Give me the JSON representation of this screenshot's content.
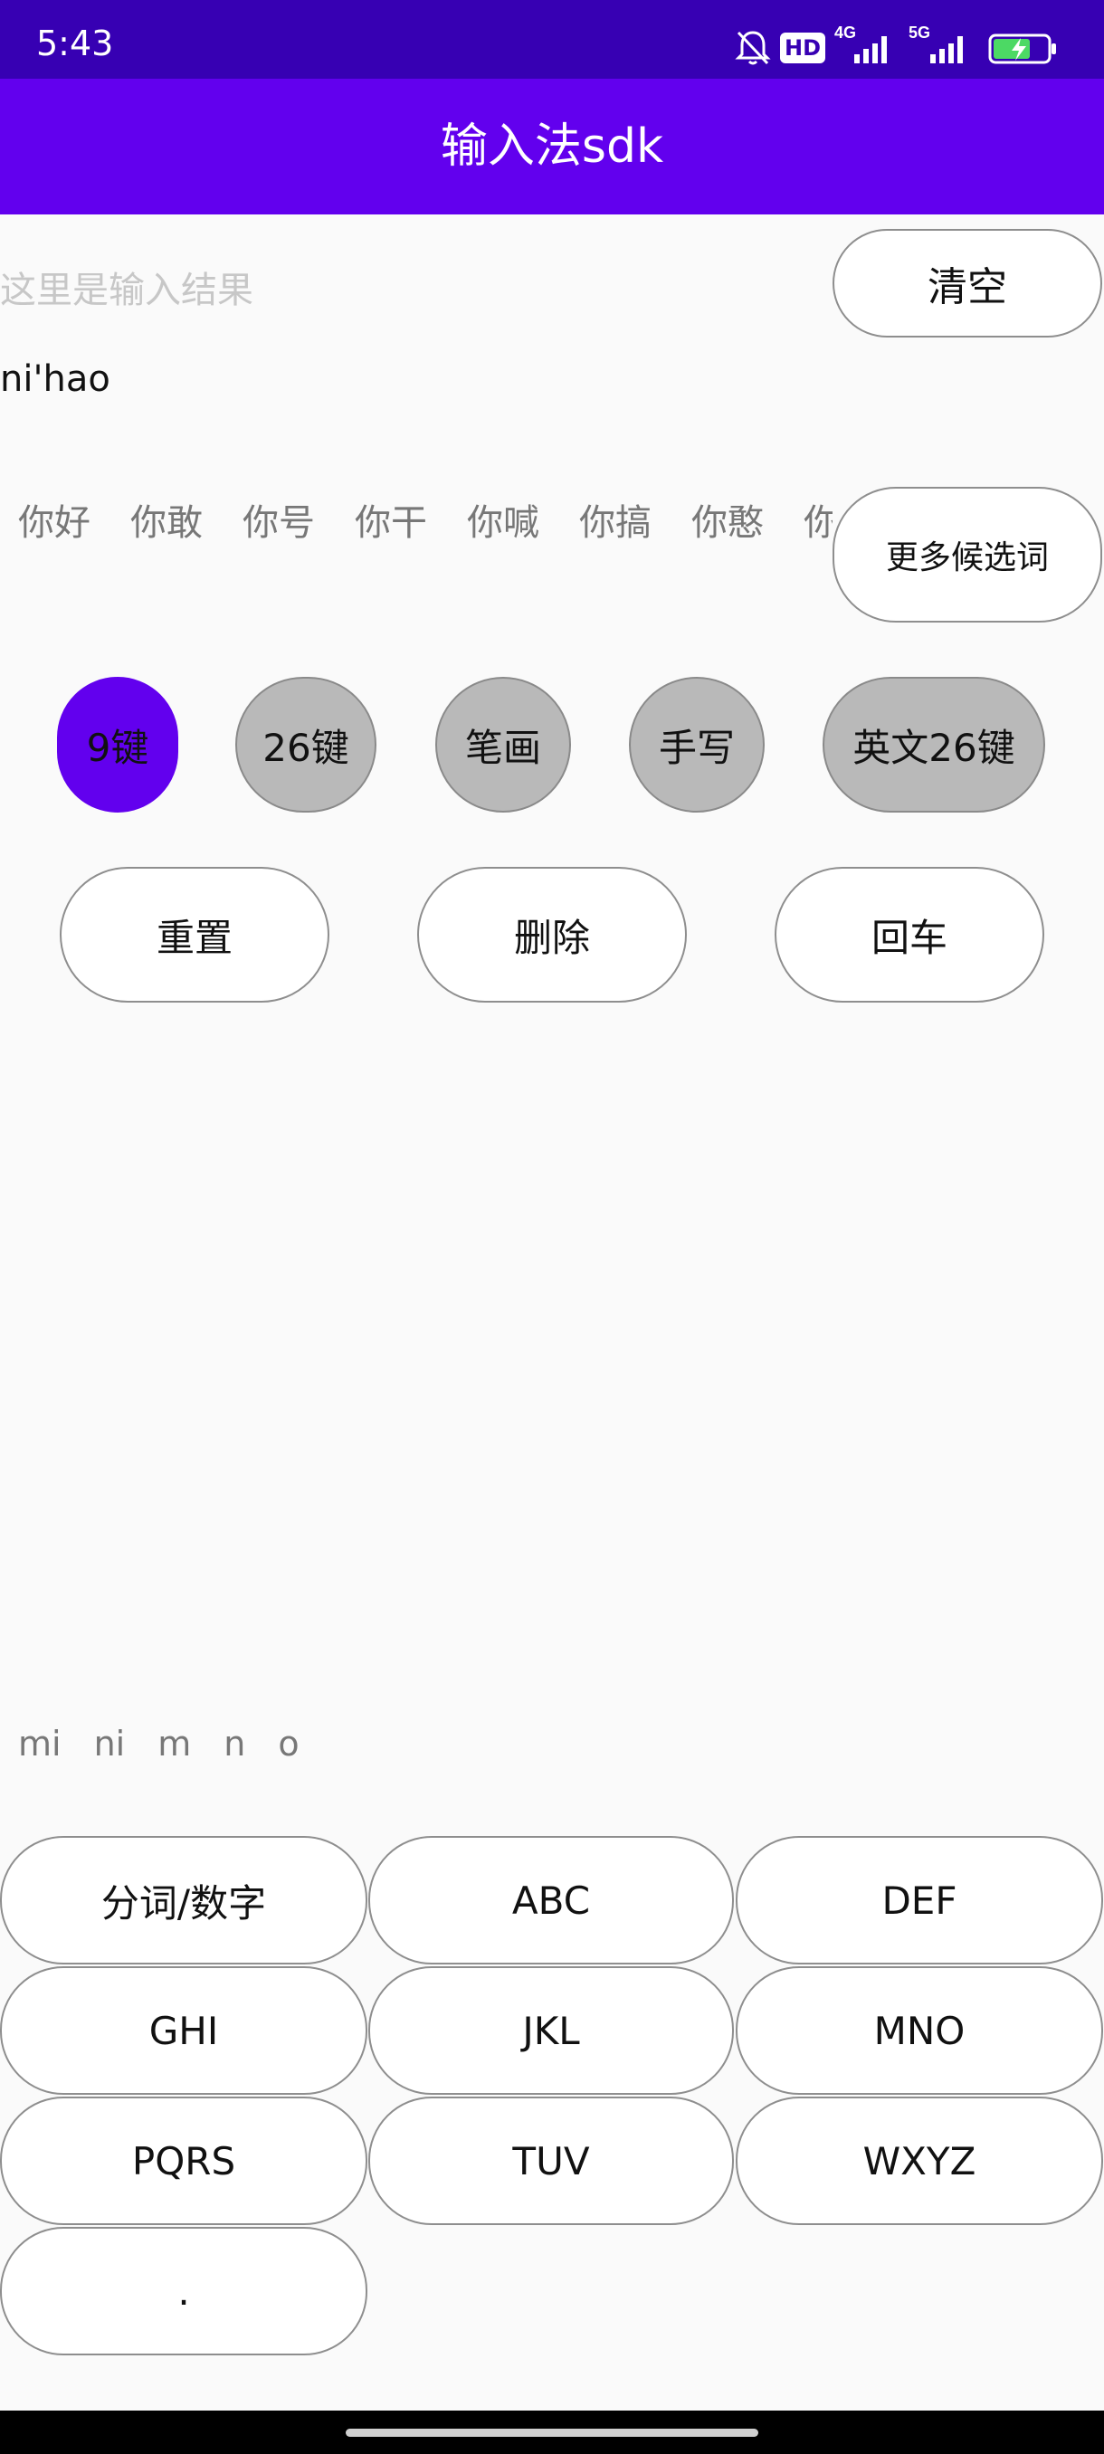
{
  "status_bar": {
    "time": "5:43",
    "hd_label": "HD",
    "net1": "4G",
    "net2": "5G",
    "icons": [
      "bell-muted-icon",
      "hd-icon",
      "signal-4g-icon",
      "signal-5g-icon",
      "battery-charging-icon"
    ]
  },
  "app_bar": {
    "title": "输入法sdk"
  },
  "result": {
    "placeholder": "这里是输入结果",
    "clear_label": "清空"
  },
  "composing_text": "ni'hao",
  "candidates": [
    "你好",
    "你敢",
    "你号",
    "你干",
    "你喊",
    "你搞",
    "你憨",
    "你"
  ],
  "more_candidates_label": "更多候选词",
  "modes": [
    {
      "label": "9键",
      "active": true
    },
    {
      "label": "26键",
      "active": false
    },
    {
      "label": "笔画",
      "active": false
    },
    {
      "label": "手写",
      "active": false
    },
    {
      "label": "英文26键",
      "active": false
    }
  ],
  "actions": {
    "reset": "重置",
    "delete": "删除",
    "enter": "回车"
  },
  "pinyin_options": [
    "mi",
    "ni",
    "m",
    "n",
    "o"
  ],
  "keypad": {
    "k1": "分词/数字",
    "k2": "ABC",
    "k3": "DEF",
    "k4": "GHI",
    "k5": "JKL",
    "k6": "MNO",
    "k7": "PQRS",
    "k8": "TUV",
    "k9": "WXYZ",
    "k10": "."
  },
  "colors": {
    "status_bar": "#3700b3",
    "primary": "#6200ee",
    "mode_inactive": "#b9b9b9"
  }
}
